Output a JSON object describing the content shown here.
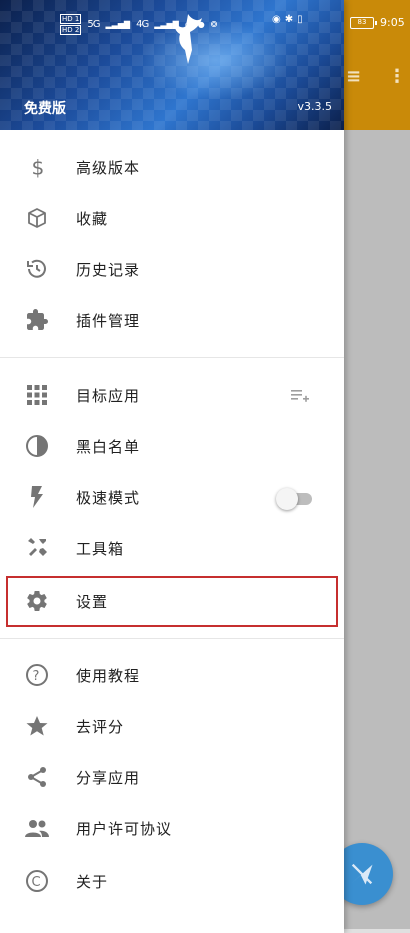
{
  "status_bar": {
    "left": {
      "hd1": "HD 1",
      "hd2": "HD 2",
      "signal_1": "5G",
      "signal_2": "4G"
    },
    "right": {
      "battery": "83",
      "time": "9:05"
    }
  },
  "drawer": {
    "header": {
      "edition": "免费版",
      "version": "v3.3.5"
    },
    "sections": [
      {
        "items": [
          {
            "label": "高级版本",
            "icon": "dollar-icon"
          },
          {
            "label": "收藏",
            "icon": "cube-icon"
          },
          {
            "label": "历史记录",
            "icon": "history-icon"
          },
          {
            "label": "插件管理",
            "icon": "extension-icon"
          }
        ]
      },
      {
        "items": [
          {
            "label": "目标应用",
            "icon": "grid-apps-icon",
            "trailing": "playlist-add-icon"
          },
          {
            "label": "黑白名单",
            "icon": "contrast-icon"
          },
          {
            "label": "极速模式",
            "icon": "flash-icon",
            "trailing": "toggle",
            "toggle_on": false
          },
          {
            "label": "工具箱",
            "icon": "tools-icon"
          },
          {
            "label": "设置",
            "icon": "gear-icon",
            "highlighted": true
          }
        ]
      },
      {
        "items": [
          {
            "label": "使用教程",
            "icon": "help-circle-icon"
          },
          {
            "label": "去评分",
            "icon": "star-icon"
          },
          {
            "label": "分享应用",
            "icon": "share-icon"
          },
          {
            "label": "用户许可协议",
            "icon": "people-icon"
          },
          {
            "label": "关于",
            "icon": "copyright-icon"
          }
        ]
      }
    ]
  },
  "colors": {
    "toolbar_bg": "#c98a09",
    "highlight_border": "#c62f2f",
    "fab_bg": "#3a8fd0",
    "icon_gray": "#757575"
  }
}
